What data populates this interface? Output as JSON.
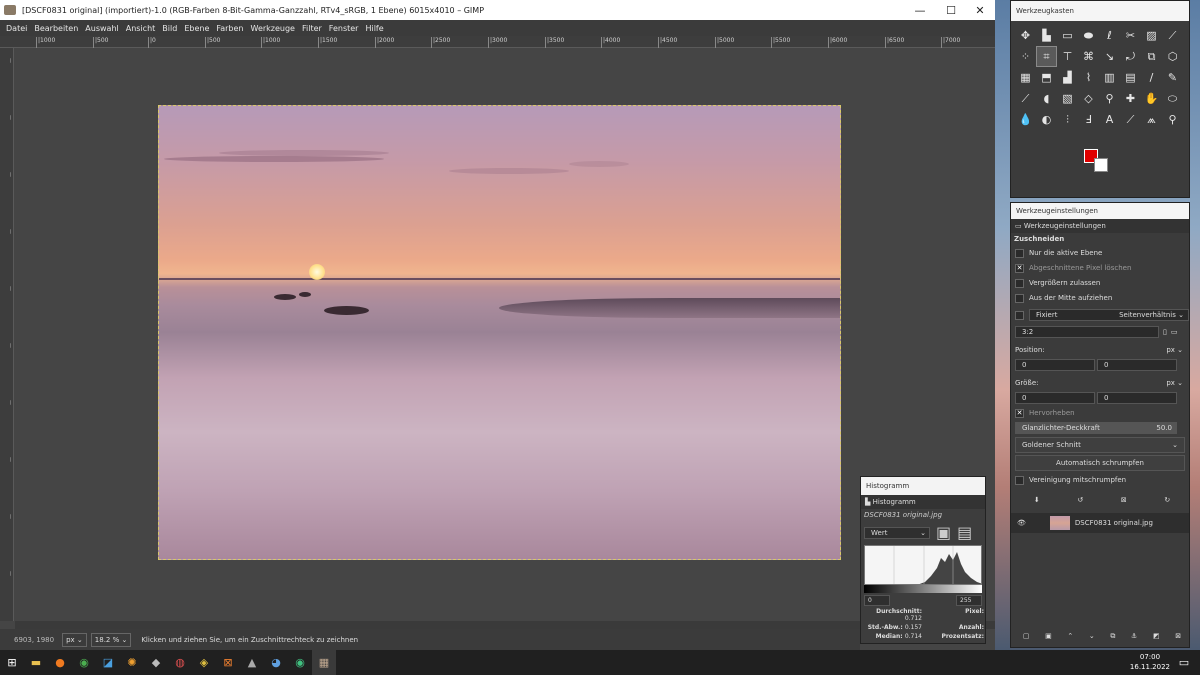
{
  "window": {
    "title": "[DSCF0831 original] (importiert)-1.0 (RGB-Farben 8-Bit-Gamma-Ganzzahl, RTv4_sRGB, 1 Ebene) 6015x4010 – GIMP",
    "minimize": "—",
    "maximize": "☐",
    "close": "✕"
  },
  "menu": [
    "Datei",
    "Bearbeiten",
    "Auswahl",
    "Ansicht",
    "Bild",
    "Ebene",
    "Farben",
    "Werkzeuge",
    "Filter",
    "Fenster",
    "Hilfe"
  ],
  "ruler_ticks": [
    "|1000",
    "|500",
    "|0",
    "|500",
    "|1000",
    "|1500",
    "|2000",
    "|2500",
    "|3000",
    "|3500",
    "|4000",
    "|4500",
    "|5000",
    "|5500",
    "|6000",
    "|6500",
    "|7000"
  ],
  "status": {
    "coords": "6903, 1980",
    "unit": "px",
    "zoom": "18.2 %",
    "message": "Klicken und ziehen Sie, um ein Zuschnittrechteck zu zeichnen"
  },
  "histogram": {
    "title": "Histogramm",
    "tab": "Histogramm",
    "filename": "DSCF0831 original.jpg",
    "channel": "Wert",
    "range_low": "0",
    "range_high": "255",
    "stats": [
      {
        "label": "Durchschnitt:",
        "value": "0.712",
        "label2": "Pixel:",
        "value2": ""
      },
      {
        "label": "Std.-Abw.:",
        "value": "0.157",
        "label2": "Anzahl:",
        "value2": ""
      },
      {
        "label": "Median:",
        "value": "0.714",
        "label2": "Prozentsatz:",
        "value2": ""
      }
    ]
  },
  "toolbox": {
    "title": "Werkzeugkasten",
    "fg_color": "#e00000",
    "bg_color": "#ffffff",
    "tools": [
      {
        "name": "move-tool-icon",
        "glyph": "✥"
      },
      {
        "name": "align-tool-icon",
        "glyph": "▙"
      },
      {
        "name": "rect-select-icon",
        "glyph": "▭"
      },
      {
        "name": "ellipse-select-icon",
        "glyph": "⬬"
      },
      {
        "name": "free-select-icon",
        "glyph": "ℓ"
      },
      {
        "name": "scissors-icon",
        "glyph": "✂"
      },
      {
        "name": "foreground-select-icon",
        "glyph": "▨"
      },
      {
        "name": "fuzzy-select-icon",
        "glyph": "⟋"
      },
      {
        "name": "by-color-select-icon",
        "glyph": "⁘"
      },
      {
        "name": "crop-tool-icon",
        "glyph": "⌗"
      },
      {
        "name": "unified-transform-icon",
        "glyph": "⊤"
      },
      {
        "name": "warp-transform-icon",
        "glyph": "⌘"
      },
      {
        "name": "handle-transform-icon",
        "glyph": "↘"
      },
      {
        "name": "rotate-icon",
        "glyph": "⤾"
      },
      {
        "name": "scale-icon",
        "glyph": "⧉"
      },
      {
        "name": "perspective-icon",
        "glyph": "⬡"
      },
      {
        "name": "cage-transform-icon",
        "glyph": "▦"
      },
      {
        "name": "bucket-fill-icon",
        "glyph": "⬒"
      },
      {
        "name": "gradient-icon",
        "glyph": "▟"
      },
      {
        "name": "paths-icon",
        "glyph": "⌇"
      },
      {
        "name": "text-box-icon",
        "glyph": "▥"
      },
      {
        "name": "mypaint-brush-icon",
        "glyph": "▤"
      },
      {
        "name": "paintbrush-icon",
        "glyph": "/"
      },
      {
        "name": "pencil-icon",
        "glyph": "✎"
      },
      {
        "name": "airbrush-icon",
        "glyph": "⟋"
      },
      {
        "name": "ink-icon",
        "glyph": "◖"
      },
      {
        "name": "pattern-icon",
        "glyph": "▧"
      },
      {
        "name": "eraser-icon",
        "glyph": "◇"
      },
      {
        "name": "clone-icon",
        "glyph": "⚲"
      },
      {
        "name": "heal-icon",
        "glyph": "✚"
      },
      {
        "name": "smudge-icon",
        "glyph": "✋"
      },
      {
        "name": "dodge-icon",
        "glyph": "⬭"
      },
      {
        "name": "blur-icon",
        "glyph": "💧"
      },
      {
        "name": "measure-icon",
        "glyph": "◐"
      },
      {
        "name": "zoom-align-icon",
        "glyph": "⫶"
      },
      {
        "name": "fill-text-icon",
        "glyph": "Ⅎ"
      },
      {
        "name": "text-tool-icon",
        "glyph": "A"
      },
      {
        "name": "color-picker-icon",
        "glyph": "⟋"
      },
      {
        "name": "compass-icon",
        "glyph": "⩕"
      },
      {
        "name": "zoom-tool-icon",
        "glyph": "⚲"
      }
    ]
  },
  "tooloptions": {
    "title": "Werkzeugeinstellungen",
    "tab": "Werkzeugeinstellungen",
    "section": "Zuschneiden",
    "opt_layer": "Nur die aktive Ebene",
    "opt_delete": "Abgeschnittene Pixel löschen",
    "opt_grow": "Vergrößern zulassen",
    "opt_center": "Aus der Mitte aufziehen",
    "fixed": "Fixiert",
    "fixed_mode": "Seitenverhältnis",
    "ratio": "3:2",
    "position_label": "Position:",
    "size_label": "Größe:",
    "unit": "px",
    "pos_x": "0",
    "pos_y": "0",
    "size_w": "0",
    "size_h": "0",
    "highlight": "Hervorheben",
    "highlight_opacity_label": "Glanzlichter-Deckkraft",
    "highlight_opacity": "50.0",
    "guides": "Goldener Schnitt",
    "auto_shrink": "Automatisch schrumpfen",
    "shrink_merged": "Vereinigung mitschrumpfen",
    "layer_name": "DSCF0831 original.jpg"
  },
  "taskbar": {
    "time": "07:00",
    "date": "16.11.2022"
  }
}
